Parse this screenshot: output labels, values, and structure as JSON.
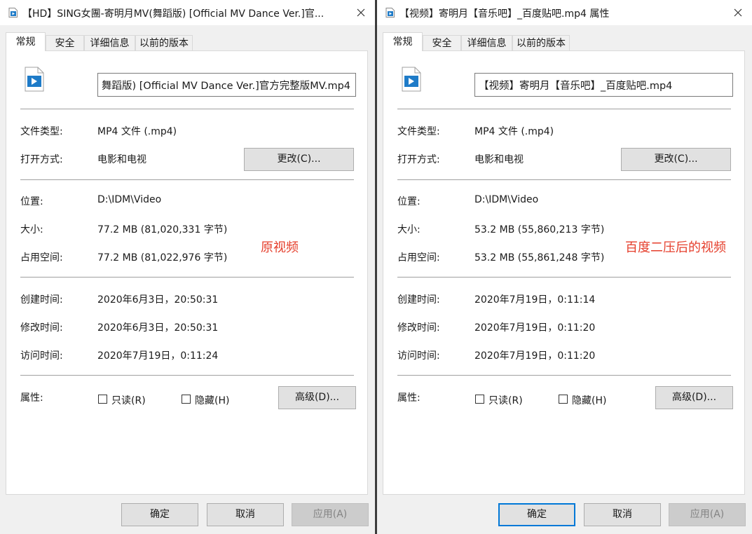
{
  "dialogs": [
    {
      "title": "【HD】SING女團-寄明月MV(舞蹈版) [Official MV Dance Ver.]官...",
      "tabs": [
        "常规",
        "安全",
        "详细信息",
        "以前的版本"
      ],
      "filename": "舞蹈版) [Official MV Dance Ver.]官方完整版MV.mp4",
      "file_type_label": "文件类型:",
      "file_type": "MP4 文件 (.mp4)",
      "open_with_label": "打开方式:",
      "open_with": "电影和电视",
      "change_button": "更改(C)...",
      "location_label": "位置:",
      "location": "D:\\IDM\\Video",
      "size_label": "大小:",
      "size": "77.2 MB (81,020,331 字节)",
      "size_on_disk_label": "占用空间:",
      "size_on_disk": "77.2 MB (81,022,976 字节)",
      "created_label": "创建时间:",
      "created": "2020年6月3日，20:50:31",
      "modified_label": "修改时间:",
      "modified": "2020年6月3日，20:50:31",
      "accessed_label": "访问时间:",
      "accessed": "2020年7月19日，0:11:24",
      "attributes_label": "属性:",
      "readonly_label": "只读(R)",
      "hidden_label": "隐藏(H)",
      "advanced_button": "高级(D)...",
      "ok_button": "确定",
      "cancel_button": "取消",
      "apply_button": "应用(A)",
      "annotation": "原视频"
    },
    {
      "title": "【视频】寄明月【音乐吧】_百度贴吧.mp4 属性",
      "tabs": [
        "常规",
        "安全",
        "详细信息",
        "以前的版本"
      ],
      "filename": "【视频】寄明月【音乐吧】_百度贴吧.mp4",
      "file_type_label": "文件类型:",
      "file_type": "MP4 文件 (.mp4)",
      "open_with_label": "打开方式:",
      "open_with": "电影和电视",
      "change_button": "更改(C)...",
      "location_label": "位置:",
      "location": "D:\\IDM\\Video",
      "size_label": "大小:",
      "size": "53.2 MB (55,860,213 字节)",
      "size_on_disk_label": "占用空间:",
      "size_on_disk": "53.2 MB (55,861,248 字节)",
      "created_label": "创建时间:",
      "created": "2020年7月19日，0:11:14",
      "modified_label": "修改时间:",
      "modified": "2020年7月19日，0:11:20",
      "accessed_label": "访问时间:",
      "accessed": "2020年7月19日，0:11:20",
      "attributes_label": "属性:",
      "readonly_label": "只读(R)",
      "hidden_label": "隐藏(H)",
      "advanced_button": "高级(D)...",
      "ok_button": "确定",
      "cancel_button": "取消",
      "apply_button": "应用(A)",
      "annotation": "百度二压后的视频"
    }
  ],
  "icons": {
    "title": "video-file-icon",
    "close": "close-icon",
    "file": "video-file-icon"
  },
  "colors": {
    "accent": "#0078d7",
    "annotation": "#e53e2b",
    "icon_blue": "#1e7bc8"
  }
}
